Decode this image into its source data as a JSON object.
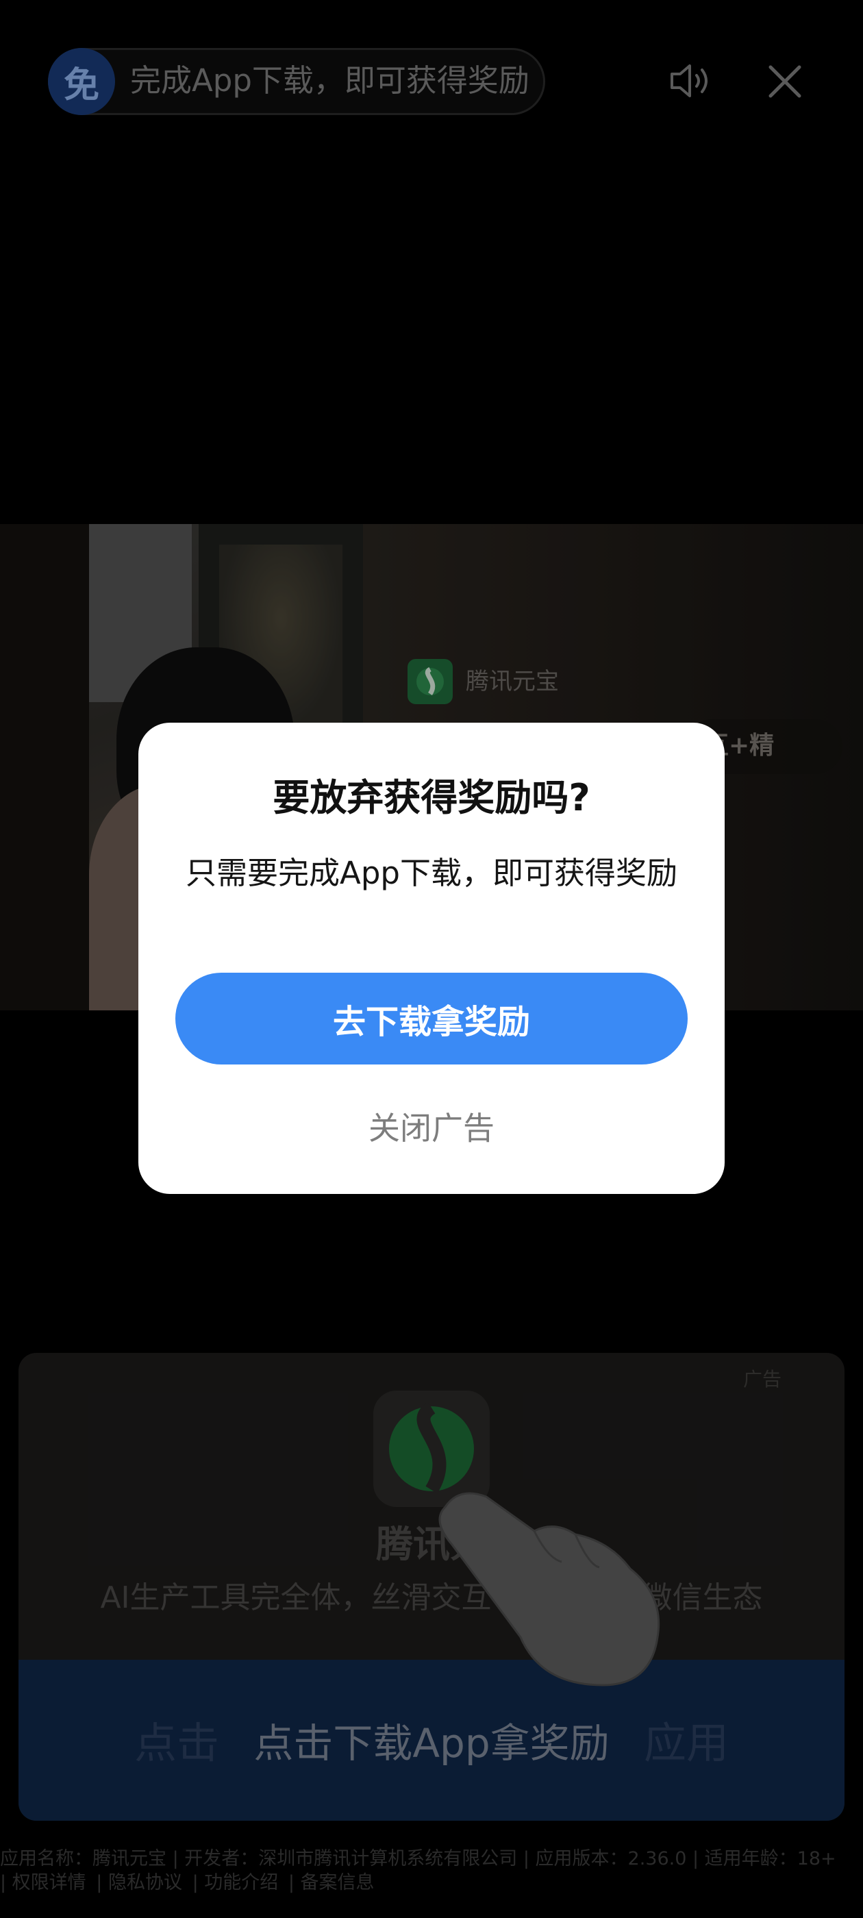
{
  "topbar": {
    "badge": "免",
    "reward_text": "完成App下载，即可获得奖励"
  },
  "video_ad": {
    "app_name": "腾讯元宝",
    "slogan_fragment": "互+精"
  },
  "ad_card": {
    "ad_label": "广告",
    "app_name": "腾讯元",
    "app_desc": "AI生产工具完全体，丝滑交互　　　　　微信生态",
    "button_ghost": "点击　　　　　　　　　　应用",
    "button_label": "点击下载App拿奖励"
  },
  "footer": {
    "info": "应用名称：腾讯元宝 | 开发者：深圳市腾讯计算机系统有限公司 | 应用版本：2.36.0 | 适用年龄：18+",
    "links": [
      "| 权限详情",
      "| 隐私协议",
      "| 功能介绍",
      "| 备案信息"
    ]
  },
  "dialog": {
    "title": "要放弃获得奖励吗?",
    "message": "只需要完成App下载，即可获得奖励",
    "primary_button": "去下载拿奖励",
    "secondary_button": "关闭广告"
  },
  "colors": {
    "primary_blue": "#3a8af5",
    "badge_blue": "#1a3b78",
    "brand_green": "#1f6a3b"
  }
}
